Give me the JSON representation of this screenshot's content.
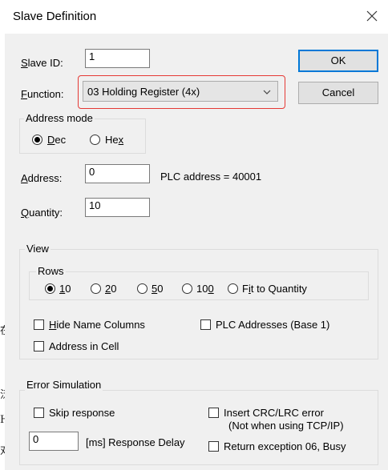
{
  "title": "Slave Definition",
  "slave_id": {
    "label_prefix": "",
    "label_u": "S",
    "label_rest": "lave ID:",
    "value": "1"
  },
  "function": {
    "label_u": "F",
    "label_rest": "unction:",
    "value": "03 Holding Register (4x)"
  },
  "buttons": {
    "ok": "OK",
    "cancel": "Cancel"
  },
  "address_mode": {
    "title": "Address mode",
    "dec": {
      "pre": "",
      "u": "D",
      "post": "ec",
      "selected": true
    },
    "hex": {
      "pre": "He",
      "u": "x",
      "post": "",
      "selected": false
    }
  },
  "address": {
    "label_u": "A",
    "label_rest": "ddress:",
    "value": "0",
    "plc_text": "PLC address = 40001"
  },
  "quantity": {
    "label_u": "Q",
    "label_rest": "uantity:",
    "value": "10"
  },
  "view": {
    "title": "View",
    "rows_title": "Rows",
    "rows": [
      {
        "pre": "",
        "u": "1",
        "post": "0",
        "selected": true
      },
      {
        "pre": "",
        "u": "2",
        "post": "0",
        "selected": false
      },
      {
        "pre": "",
        "u": "5",
        "post": "0",
        "selected": false
      },
      {
        "pre": "10",
        "u": "0",
        "post": "",
        "selected": false
      },
      {
        "pre": "F",
        "u": "i",
        "post": "t to Quantity",
        "selected": false
      }
    ],
    "hide_name_columns": {
      "pre": "",
      "u": "H",
      "post": "ide Name Columns",
      "checked": false
    },
    "plc_addresses": {
      "label": "PLC Addresses (Base 1)",
      "checked": false
    },
    "address_in_cell": {
      "label": "Address in Cell",
      "checked": false
    }
  },
  "error_simulation": {
    "title": "Error Simulation",
    "skip_response": {
      "label": "Skip response",
      "checked": false
    },
    "response_delay": {
      "value": "0",
      "label": "[ms] Response Delay"
    },
    "insert_crc": {
      "label_1": "Insert CRC/LRC error",
      "label_2": "(Not when using TCP/IP)",
      "checked": false
    },
    "return_exception": {
      "label": "Return exception 06, Busy",
      "checked": false
    }
  },
  "background_chars": [
    "在",
    "泛",
    "H",
    "对"
  ],
  "icons": {
    "close": "close-icon",
    "dropdown": "chevron-down-icon"
  }
}
